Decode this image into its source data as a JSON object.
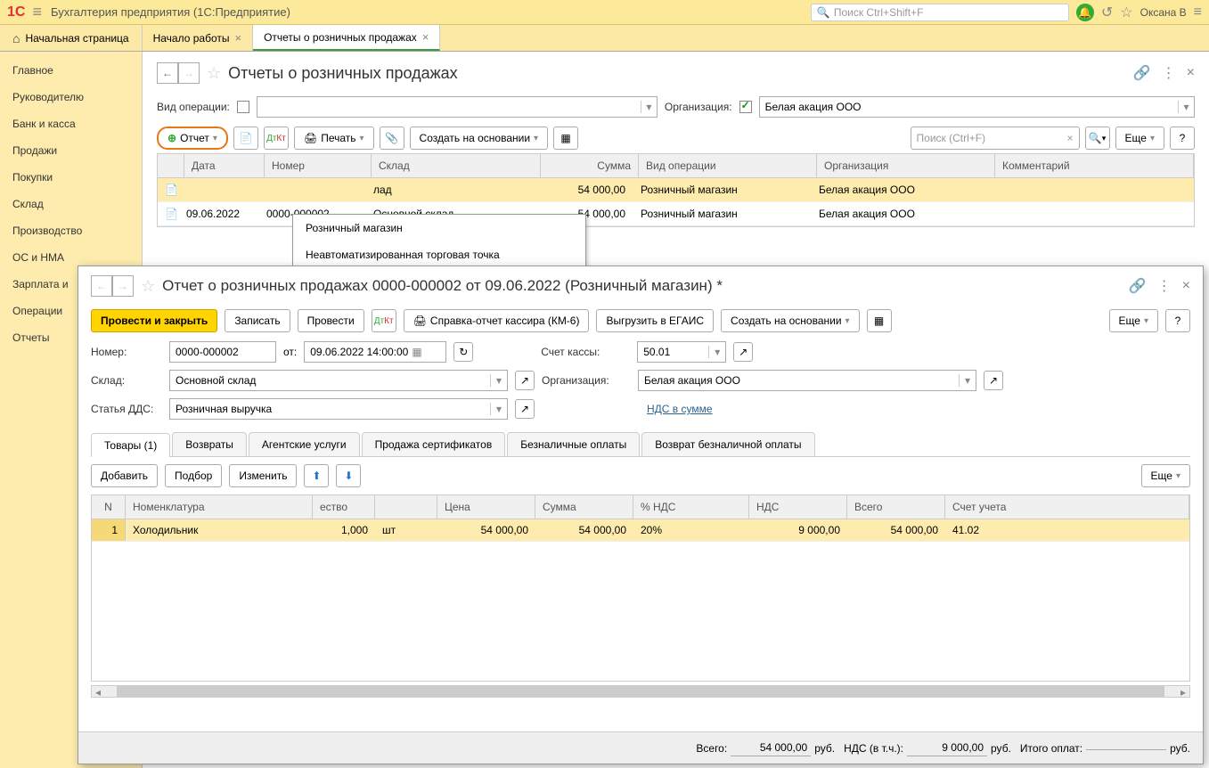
{
  "header": {
    "app_title": "Бухгалтерия предприятия  (1С:Предприятие)",
    "search_placeholder": "Поиск Ctrl+Shift+F",
    "user": "Оксана В"
  },
  "tabs": {
    "home": "Начальная страница",
    "items": [
      {
        "label": "Начало работы"
      },
      {
        "label": "Отчеты о розничных продажах"
      }
    ]
  },
  "sidebar": {
    "items": [
      "Главное",
      "Руководителю",
      "Банк и касса",
      "Продажи",
      "Покупки",
      "Склад",
      "Производство",
      "ОС и НМА",
      "Зарплата и",
      "Операции",
      "Отчеты"
    ]
  },
  "list_view": {
    "title": "Отчеты о розничных продажах",
    "filter_operation_label": "Вид операции:",
    "filter_org_label": "Организация:",
    "org_value": "Белая акация ООО",
    "report_btn": "Отчет",
    "print_btn": "Печать",
    "create_based": "Создать на основании",
    "more_btn": "Еще",
    "search_placeholder": "Поиск (Ctrl+F)",
    "dropdown": [
      "Розничный магазин",
      "Неавтоматизированная торговая точка"
    ],
    "columns": [
      "",
      "Дата",
      "Номер",
      "Склад",
      "Сумма",
      "Вид операции",
      "Организация",
      "Комментарий"
    ],
    "rows": [
      {
        "date": "",
        "num": "",
        "warehouse": "лад",
        "sum": "54 000,00",
        "oper": "Розничный магазин",
        "org": "Белая акация ООО"
      },
      {
        "date": "09.06.2022",
        "num": "0000-000002",
        "warehouse": "Основной склад",
        "sum": "54 000,00",
        "oper": "Розничный магазин",
        "org": "Белая акация ООО"
      }
    ]
  },
  "modal": {
    "title": "Отчет о розничных продажах 0000-000002 от 09.06.2022 (Розничный магазин) *",
    "btn_post_close": "Провести и закрыть",
    "btn_write": "Записать",
    "btn_post": "Провести",
    "btn_km6": "Справка-отчет кассира (КМ-6)",
    "btn_egais": "Выгрузить в ЕГАИС",
    "btn_create_based": "Создать на основании",
    "btn_more": "Еще",
    "label_number": "Номер:",
    "val_number": "0000-000002",
    "label_from": "от:",
    "val_from": "09.06.2022 14:00:00",
    "label_account": "Счет кассы:",
    "val_account": "50.01",
    "label_warehouse": "Склад:",
    "val_warehouse": "Основной склад",
    "label_org": "Организация:",
    "val_org": "Белая акация ООО",
    "label_dds": "Статья ДДС:",
    "val_dds": "Розничная выручка",
    "link_nds": "НДС в сумме",
    "tabs": [
      "Товары (1)",
      "Возвраты",
      "Агентские услуги",
      "Продажа сертификатов",
      "Безналичные оплаты",
      "Возврат безналичной оплаты"
    ],
    "btn_add": "Добавить",
    "btn_select": "Подбор",
    "btn_edit": "Изменить",
    "grid_cols": [
      "N",
      "Номенклатура",
      "ество",
      "",
      "Цена",
      "Сумма",
      "% НДС",
      "НДС",
      "Всего",
      "Счет учета"
    ],
    "grid_row": {
      "n": "1",
      "nom": "Холодильник",
      "qty": "1,000",
      "unit": "шт",
      "price": "54 000,00",
      "sum": "54 000,00",
      "nds_pct": "20%",
      "nds": "9 000,00",
      "total": "54 000,00",
      "account": "41.02"
    },
    "footer": {
      "total_label": "Всего:",
      "total": "54 000,00",
      "rub": "руб.",
      "nds_label": "НДС (в т.ч.):",
      "nds": "9 000,00",
      "pay_label": "Итого оплат:"
    }
  }
}
